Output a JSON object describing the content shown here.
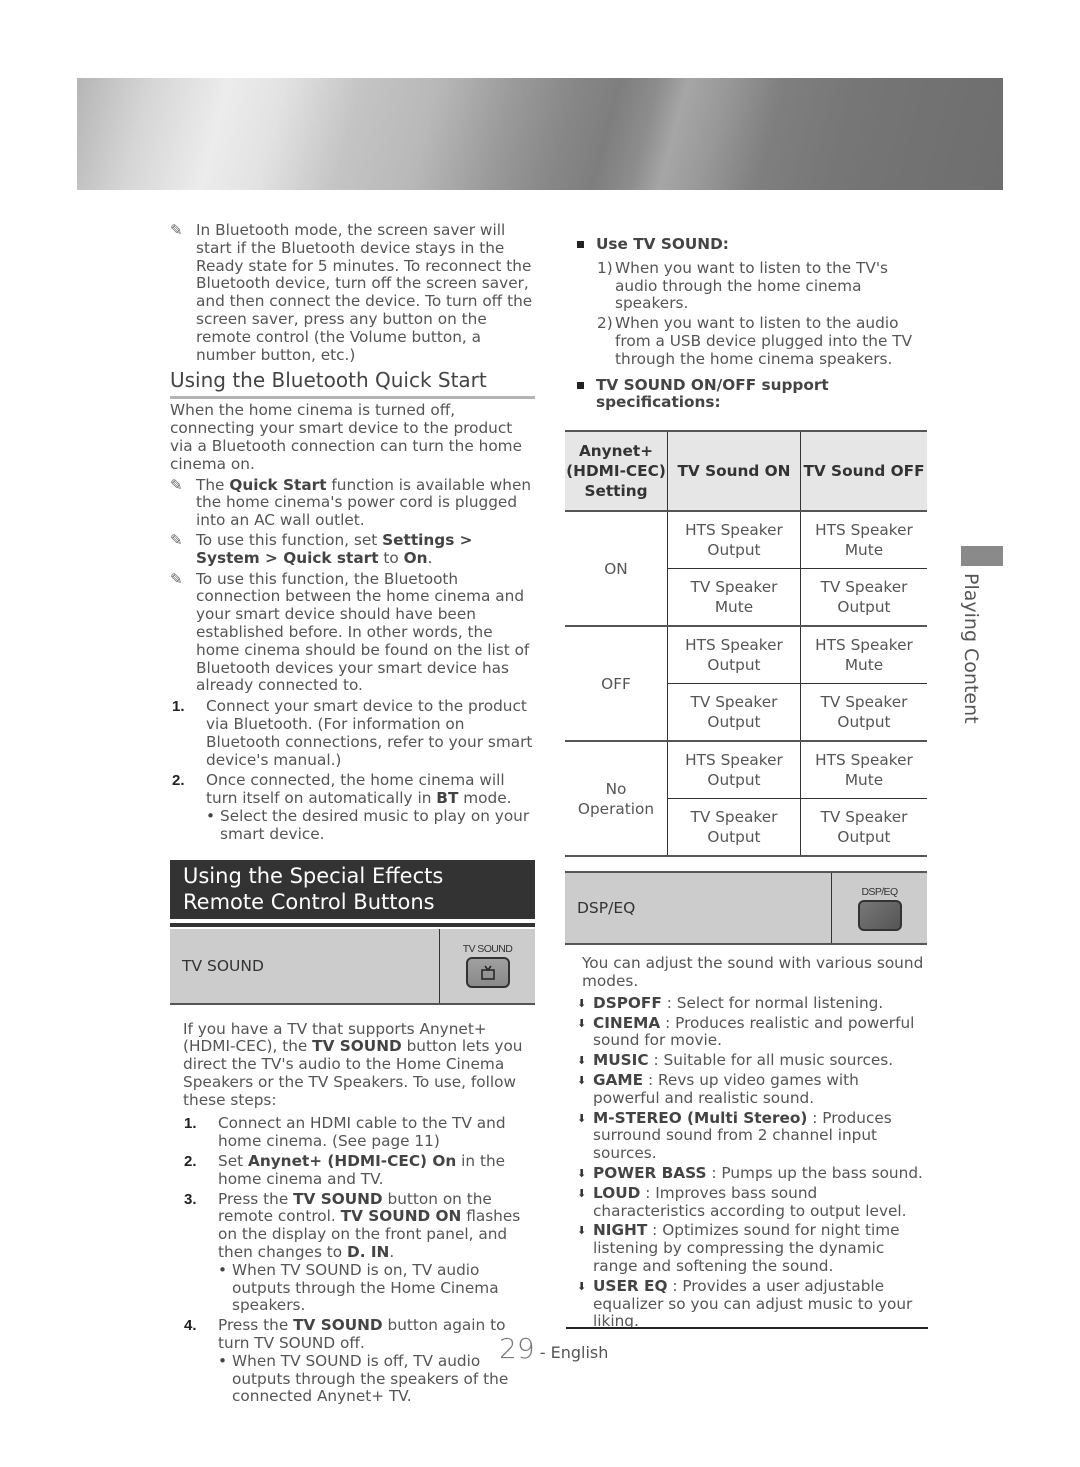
{
  "banner": {
    "icon": "decorative-banner"
  },
  "side_tab": {
    "label": "Playing Content"
  },
  "left": {
    "note_screen_saver": "In Bluetooth mode, the screen saver will start if the Bluetooth device stays in the Ready state for 5 minutes. To reconnect the Bluetooth device, turn off the screen saver, and then connect the device. To turn off the screen saver, press any button on the remote control (the Volume button, a number button, etc.)",
    "quick_start": {
      "title": "Using the Bluetooth Quick Start",
      "intro": "When the home cinema is turned off, connecting your smart device to the product via a Bluetooth connection can turn the home cinema on.",
      "note1": {
        "pre": "The ",
        "bold": "Quick Start",
        "post": " function is available when the home cinema's power cord is plugged into an AC wall outlet."
      },
      "note2": {
        "pre": "To use this function, set ",
        "b1": "Settings",
        "sep1": " > ",
        "b2": "System",
        "sep2": " > ",
        "b3": "Quick start",
        "mid": " to ",
        "b4": "On",
        "post": "."
      },
      "note3": "To use this function, the Bluetooth connection between the home cinema and your smart device should have been established before. In other words, the home cinema should be found on the list of Bluetooth devices your smart device has already connected to.",
      "steps": [
        {
          "n": "1.",
          "text": "Connect your smart device to the product via Bluetooth. (For information on Bluetooth connections, refer to your smart device's manual.)"
        },
        {
          "n": "2.",
          "pre": "Once connected, the home cinema will turn itself on automatically in ",
          "bold": "BT",
          "post": " mode.",
          "bullet": "Select the desired music to play on your smart device."
        }
      ]
    },
    "special_effects": {
      "title": "Using the Special Effects Remote Control Buttons",
      "button_label": "TV SOUND",
      "button_caption": "TV SOUND",
      "intro": {
        "pre": "If you have a TV that supports Anynet+ (HDMI-CEC), the ",
        "bold": "TV SOUND",
        "post": " button lets you direct the TV's audio to the Home Cinema Speakers or the TV Speakers. To use, follow these steps:"
      },
      "steps": [
        {
          "n": "1.",
          "text": "Connect an HDMI cable to the TV and home cinema. (See page 11)"
        },
        {
          "n": "2.",
          "pre": "Set ",
          "bold": "Anynet+ (HDMI-CEC) On",
          "post": " in the home cinema and TV."
        },
        {
          "n": "3.",
          "pre": "Press the ",
          "bold": "TV SOUND",
          "mid": " button on the remote control. ",
          "bold2": "TV SOUND ON",
          "mid2": " flashes on the display on the front panel, and then changes to ",
          "bold3": "D. IN",
          "post": ".",
          "bullet": "When TV SOUND is on, TV audio outputs through the Home Cinema speakers."
        },
        {
          "n": "4.",
          "pre": "Press the ",
          "bold": "TV SOUND",
          "post": " button again to turn TV SOUND off.",
          "bullet": "When TV SOUND is off, TV audio outputs through the speakers of the connected Anynet+ TV."
        }
      ]
    }
  },
  "right": {
    "use_tv_sound": {
      "heading": "Use TV SOUND:",
      "items": [
        {
          "n": "1)",
          "text": "When you want to listen to the TV's audio through the home cinema speakers."
        },
        {
          "n": "2)",
          "text": "When you want to listen to the audio from a USB device plugged into the TV through the home cinema speakers."
        }
      ]
    },
    "spec_heading": "TV SOUND ON/OFF support specifications:",
    "table": {
      "headers": [
        "Anynet+ (HDMI-CEC) Setting",
        "TV Sound ON",
        "TV Sound OFF"
      ],
      "header_lines": [
        "Anynet+",
        "(HDMI-CEC)",
        "Setting"
      ],
      "groups": [
        {
          "setting": "ON",
          "rows": [
            [
              "HTS Speaker Output",
              "HTS Speaker Mute"
            ],
            [
              "TV Speaker Mute",
              "TV Speaker Output"
            ]
          ]
        },
        {
          "setting": "OFF",
          "rows": [
            [
              "HTS Speaker Output",
              "HTS Speaker Mute"
            ],
            [
              "TV Speaker Output",
              "TV Speaker Output"
            ]
          ]
        },
        {
          "setting": "No Operation",
          "rows": [
            [
              "HTS Speaker Output",
              "HTS Speaker Mute"
            ],
            [
              "TV Speaker Output",
              "TV Speaker Output"
            ]
          ]
        }
      ]
    },
    "dsp": {
      "button_label": "DSP/EQ",
      "button_caption": "DSP/EQ",
      "intro": "You can adjust the sound with various sound modes.",
      "modes": [
        {
          "name": "DSPOFF",
          "desc": "Select for normal listening."
        },
        {
          "name": "CINEMA",
          "desc": "Produces realistic and powerful sound for movie."
        },
        {
          "name": "MUSIC",
          "desc": "Suitable for all music sources."
        },
        {
          "name": "GAME",
          "desc": "Revs up video games with powerful and realistic sound."
        },
        {
          "name": "M-STEREO (Multi Stereo)",
          "desc": "Produces surround sound from 2 channel input sources."
        },
        {
          "name": "POWER BASS",
          "desc": "Pumps up the bass sound."
        },
        {
          "name": "LOUD",
          "desc": "Improves bass sound characteristics according to output level."
        },
        {
          "name": "NIGHT",
          "desc": "Optimizes sound for night time listening by compressing the dynamic range and softening the sound."
        },
        {
          "name": "USER EQ",
          "desc": "Provides a user adjustable equalizer so you can adjust music to your liking."
        }
      ],
      "separator": " : "
    }
  },
  "footer": {
    "page": "29",
    "lang": "- English"
  }
}
